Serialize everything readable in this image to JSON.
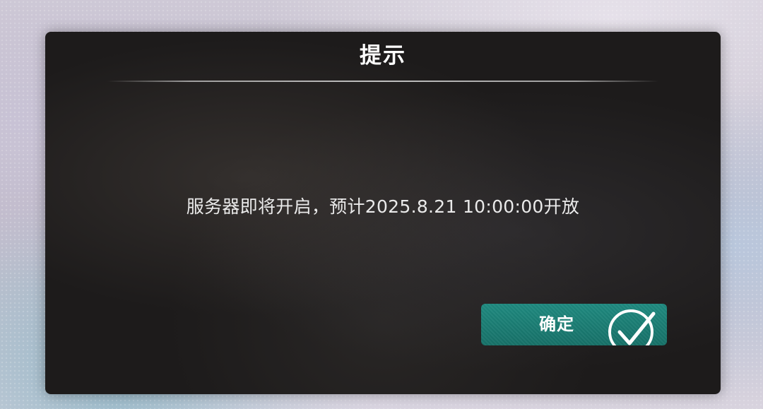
{
  "dialog": {
    "title": "提示",
    "message": "服务器即将开启，预计2025.8.21 10:00:00开放",
    "confirm_label": "确定"
  },
  "colors": {
    "dialog_bg": "#1d1b1b",
    "confirm_button": "#1b7d74",
    "text": "#ffffff"
  },
  "icons": {
    "confirm": "check-circle-icon"
  }
}
